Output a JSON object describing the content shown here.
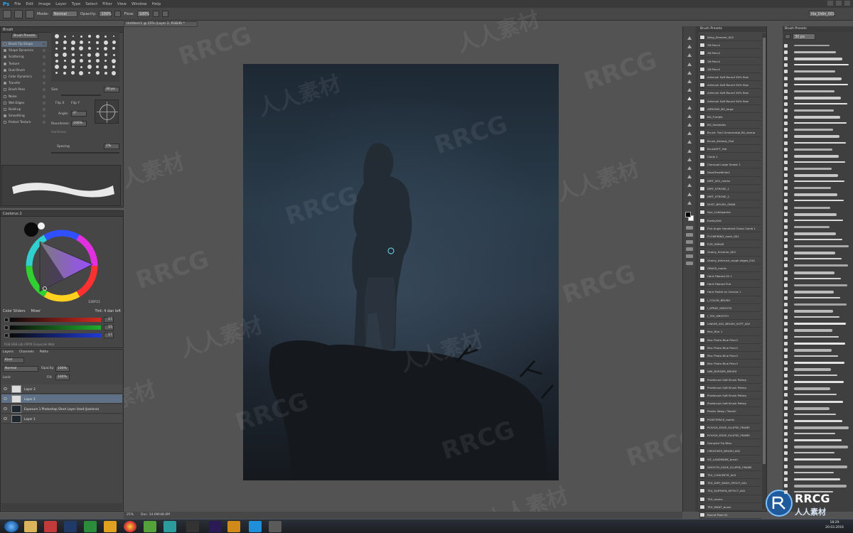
{
  "app": {
    "logo": "Ps",
    "menu": [
      "File",
      "Edit",
      "Image",
      "Layer",
      "Type",
      "Select",
      "Filter",
      "View",
      "Window",
      "Help"
    ],
    "workspace": "Ilia_Ddin_001"
  },
  "options_bar": {
    "mode_label": "Mode:",
    "mode_value": "Normal",
    "opacity_label": "Opacity:",
    "opacity_value": "100%",
    "flow_label": "Flow:",
    "flow_value": "100%"
  },
  "document": {
    "tab_title": "Untitled-1 @ 25% (Layer 2, RGB/8) *",
    "zoom": "25%",
    "doc_size": "Doc: 34.6M/48.0M"
  },
  "brush_panel": {
    "title": "Brush",
    "presets_button": "Brush Presets",
    "options": [
      {
        "label": "Brush Tip Shape",
        "on": false,
        "selected": true
      },
      {
        "label": "Shape Dynamics",
        "on": true,
        "selected": false
      },
      {
        "label": "Scattering",
        "on": true,
        "selected": false
      },
      {
        "label": "Texture",
        "on": true,
        "selected": false
      },
      {
        "label": "Dual Brush",
        "on": true,
        "selected": false
      },
      {
        "label": "Color Dynamics",
        "on": false,
        "selected": false
      },
      {
        "label": "Transfer",
        "on": true,
        "selected": false
      },
      {
        "label": "Brush Pose",
        "on": false,
        "selected": false
      },
      {
        "label": "Noise",
        "on": false,
        "selected": false
      },
      {
        "label": "Wet Edges",
        "on": false,
        "selected": false
      },
      {
        "label": "Build-up",
        "on": false,
        "selected": false
      },
      {
        "label": "Smoothing",
        "on": true,
        "selected": false
      },
      {
        "label": "Protect Texture",
        "on": false,
        "selected": false
      }
    ],
    "size_label": "Size",
    "size_value": "30 px",
    "flip_x": "Flip X",
    "flip_y": "Flip Y",
    "angle_label": "Angle:",
    "angle_value": "0°",
    "roundness_label": "Roundness:",
    "roundness_value": "100%",
    "hardness_label": "Hardness",
    "spacing_label": "Spacing",
    "spacing_value": "1%"
  },
  "color_panel": {
    "title": "Coolorus 2",
    "tabs": [
      "Color Sliders",
      "Mixer"
    ],
    "tint_label": "Tint: 4 dan left",
    "hex": "130F11",
    "sliders": [
      {
        "channel": "R",
        "value": "17",
        "color": "#d42a1f"
      },
      {
        "channel": "G",
        "value": "15",
        "color": "#1fae2a"
      },
      {
        "channel": "B",
        "value": "17",
        "color": "#1f3ad4"
      }
    ],
    "footer": "RGB  HSB  Lab  CMYK  Grayscale  Web"
  },
  "layers_panel": {
    "tabs": [
      "Layers",
      "Channels",
      "Paths"
    ],
    "kind_label": "Kind",
    "blend_value": "Normal",
    "opacity_label": "Opacity:",
    "opacity_value": "100%",
    "lock_label": "Lock:",
    "fill_label": "Fill:",
    "fill_value": "100%",
    "layers": [
      {
        "name": "Layer 3",
        "selected": false,
        "white": true
      },
      {
        "name": "Layer 2",
        "selected": true,
        "white": true
      },
      {
        "name": "Exposure 1  Photoshop Short  Layer Used (Jasmine)",
        "selected": false,
        "white": false
      },
      {
        "name": "Layer 1",
        "selected": false,
        "white": false
      }
    ]
  },
  "presets_panel": {
    "title": "Brush Presets",
    "items": [
      "Wing_Element_001",
      "2B Pencil",
      "2B Pencil",
      "2B Pencil",
      "2B Pencil",
      "Airbrush Soft Round 50% flow",
      "Airbrush Soft Round 50% flow",
      "Airbrush Soft Round 50% flow",
      "Airbrush Soft Round 50% flow",
      "ARROWS_BG_large",
      "BG_Tumble",
      "BG_Seastalks",
      "Brush: Trail Ornamental_BS_stamp",
      "Brush_Already_Flat",
      "BrushDFT_Hdr",
      "Chalk 1",
      "Charcoal Large Smear 1",
      "DeadTreeWhite1",
      "DIRT_001_marks",
      "DIRT_STROKE_1",
      "DIRT_STROKE_2",
      "DUST_BRUSH_SMAB",
      "Dye_CalkSparkle",
      "EarthyDirt",
      "Flat Angle Handheld Grass Comb 1",
      "FLOWERING_mark_001",
      "FUR_SMEAR",
      "Grainy_Scheme_003",
      "Grainy_Airbrush_rough edges_010",
      "GRASS_marks",
      "Hard Fibered Oil 1",
      "Hard Fibered Flat",
      "Hard Pastel on Canvas 1",
      "I_COLOR_BRUSH",
      "I_SPRAY_SMOOTH",
      "I_TEX_SMOOTH",
      "LINEAR_002_BRUSH_SOFT_002",
      "Mac_Blur 1",
      "Mac Photo Blue Pencil",
      "Mac Photo Blue Pencil",
      "Mac Photo Blue Pencil",
      "Mac Photo Blue Pencil",
      "NIM_BORDER_BRUSH",
      "Pixelbrush Soft Brush Pelkey",
      "Pixelbrush Soft Brush Pelkey",
      "Pixelbrush Soft Brush Pelkey",
      "Pixelbrush Soft Brush Pelkey",
      "Plastic Wrap / Tendril",
      "POINTSPACE_marks",
      "ROUGH_EDGE_ELLIPSE_FRAME",
      "ROUGH_EDGE_ELLIPSE_FRAME",
      "Sampled Tip Bliss",
      "CREATIVES_BRUSH_002",
      "SIF_LANDMARK_brush",
      "SMOOTH_EDGE_ELLIPSE_FRAME",
      "TEX_CONCRETE_003",
      "TEX_DIRT_DASH_SPOUT_001",
      "TEX_EARTHEN_EFFECT_002",
      "TEX_marks",
      "TEX_PAINT_brush",
      "Round Pixel 01"
    ]
  },
  "strokes_panel": {
    "title": "Brush Presets",
    "size_value": "30 px",
    "rows": 70
  },
  "taskbar": {
    "time": "18:29",
    "date": "20.03.2016"
  },
  "watermark": {
    "latin": "RRCG",
    "cn": "人人素材",
    "logo_text": "RRCG",
    "logo_sub": "人人素材"
  },
  "colors": {
    "ui_bg": "#535353",
    "panel_bg": "#464646",
    "selected": "#5e7186",
    "accent_ps": "#2fa3f7"
  }
}
